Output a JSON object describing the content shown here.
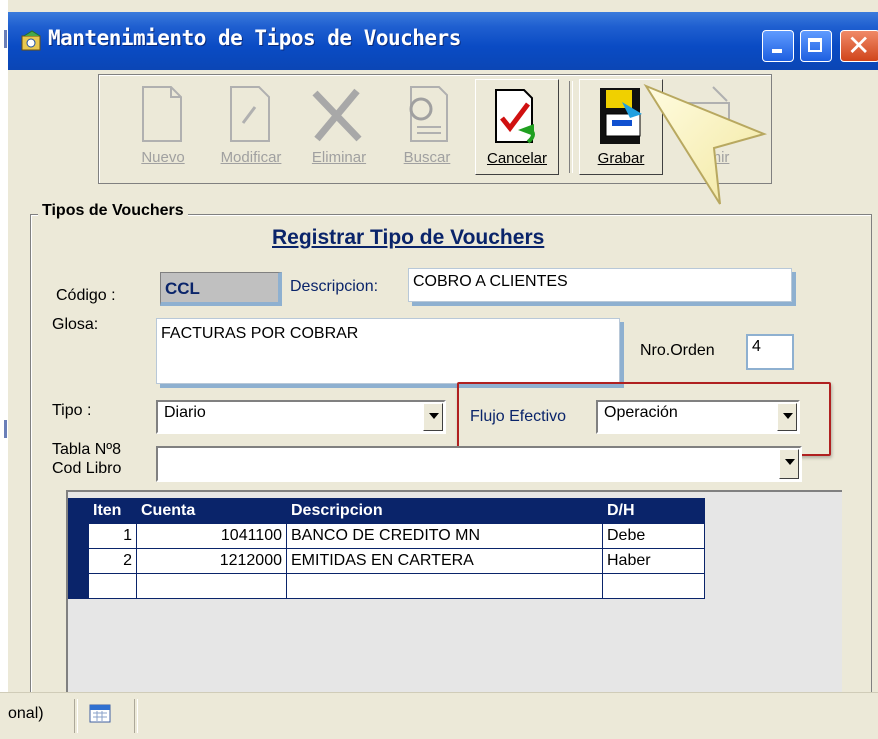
{
  "window": {
    "title": "Mantenimiento de Tipos de Vouchers"
  },
  "toolbar": {
    "buttons": [
      {
        "label": "Nuevo",
        "enabled": false
      },
      {
        "label": "Modificar",
        "enabled": false
      },
      {
        "label": "Eliminar",
        "enabled": false
      },
      {
        "label": "Buscar",
        "enabled": false
      },
      {
        "label": "Cancelar",
        "enabled": true
      },
      {
        "label": "Grabar",
        "enabled": true
      },
      {
        "label": "mir",
        "enabled": false
      }
    ]
  },
  "group": {
    "title": "Tipos de Vouchers",
    "heading": "Registrar Tipo de Vouchers"
  },
  "form": {
    "codigo_label": "Código :",
    "codigo_value": "CCL",
    "descripcion_label": "Descripcion:",
    "descripcion_value": "COBRO A CLIENTES",
    "glosa_label": "Glosa:",
    "glosa_value": "FACTURAS POR COBRAR",
    "nro_orden_label": "Nro.Orden",
    "nro_orden_value": "4",
    "tipo_label": "Tipo :",
    "tipo_value": "Diario",
    "flujo_label": "Flujo Efectivo",
    "flujo_value": "Operación",
    "tabla_label_1": "Tabla Nº8",
    "tabla_label_2": "Cod Libro",
    "tabla_value": ""
  },
  "grid": {
    "headers": [
      "Iten",
      "Cuenta",
      "Descripcion",
      "D/H"
    ],
    "rows": [
      {
        "item": "1",
        "cuenta": "1041100",
        "descripcion": "BANCO DE CREDITO MN",
        "dh": "Debe"
      },
      {
        "item": "2",
        "cuenta": "1212000",
        "descripcion": "EMITIDAS EN CARTERA",
        "dh": "Haber"
      }
    ]
  },
  "statusbar": {
    "text": "onal)"
  },
  "colors": {
    "titlebar": "#0a4bc4",
    "grid_header": "#0a246a",
    "highlight_box": "#b02020"
  }
}
